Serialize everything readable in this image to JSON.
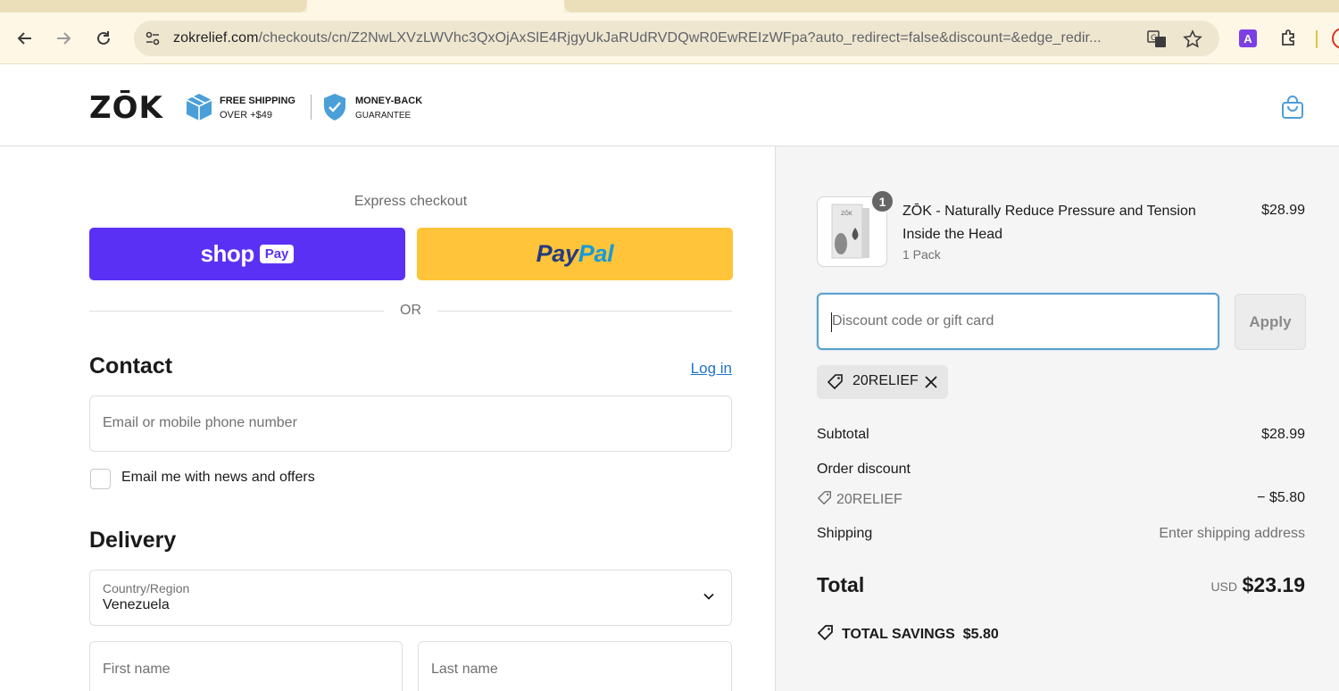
{
  "browser": {
    "url_domain": "zokrelief.com",
    "url_path": "/checkouts/cn/Z2NwLXVzLWVhc3QxOjAxSlE4RjgyUkJaRUdRVDQwR0EwREIzWFpa?auto_redirect=false&discount=&edge_redir...",
    "extension_letter": "A"
  },
  "header": {
    "logo": "ZŌK",
    "shipping_badge_line1": "FREE SHIPPING",
    "shipping_badge_line2": "OVER +$49",
    "guarantee_line1": "MONEY-BACK",
    "guarantee_line2": "GUARANTEE"
  },
  "checkout": {
    "express_label": "Express checkout",
    "shop_pay_word": "shop",
    "shop_pay_chip": "Pay",
    "paypal_part1": "Pay",
    "paypal_part2": "Pal",
    "or_text": "OR",
    "contact_title": "Contact",
    "login_link": "Log in",
    "email_placeholder": "Email or mobile phone number",
    "newsletter_label": "Email me with news and offers",
    "delivery_title": "Delivery",
    "country_label": "Country/Region",
    "country_value": "Venezuela",
    "first_name_placeholder": "First name",
    "last_name_placeholder": "Last name"
  },
  "summary": {
    "product": {
      "quantity": "1",
      "name": "ZŌK - Naturally Reduce Pressure and Tension Inside the Head",
      "variant": "1 Pack",
      "price": "$28.99"
    },
    "discount_placeholder": "Discount code or gift card",
    "apply_label": "Apply",
    "applied_code": "20RELIEF",
    "subtotal_label": "Subtotal",
    "subtotal_value": "$28.99",
    "order_discount_label": "Order discount",
    "discount_code": "20RELIEF",
    "discount_value": "− $5.80",
    "shipping_label": "Shipping",
    "shipping_value": "Enter shipping address",
    "total_label": "Total",
    "total_currency": "USD",
    "total_value": "$23.19",
    "savings_label": "TOTAL SAVINGS",
    "savings_value": "$5.80"
  },
  "colors": {
    "shop_pay": "#5a31f4",
    "paypal": "#ffc439",
    "link": "#1f74cc",
    "brand_blue": "#4a9fd8"
  }
}
